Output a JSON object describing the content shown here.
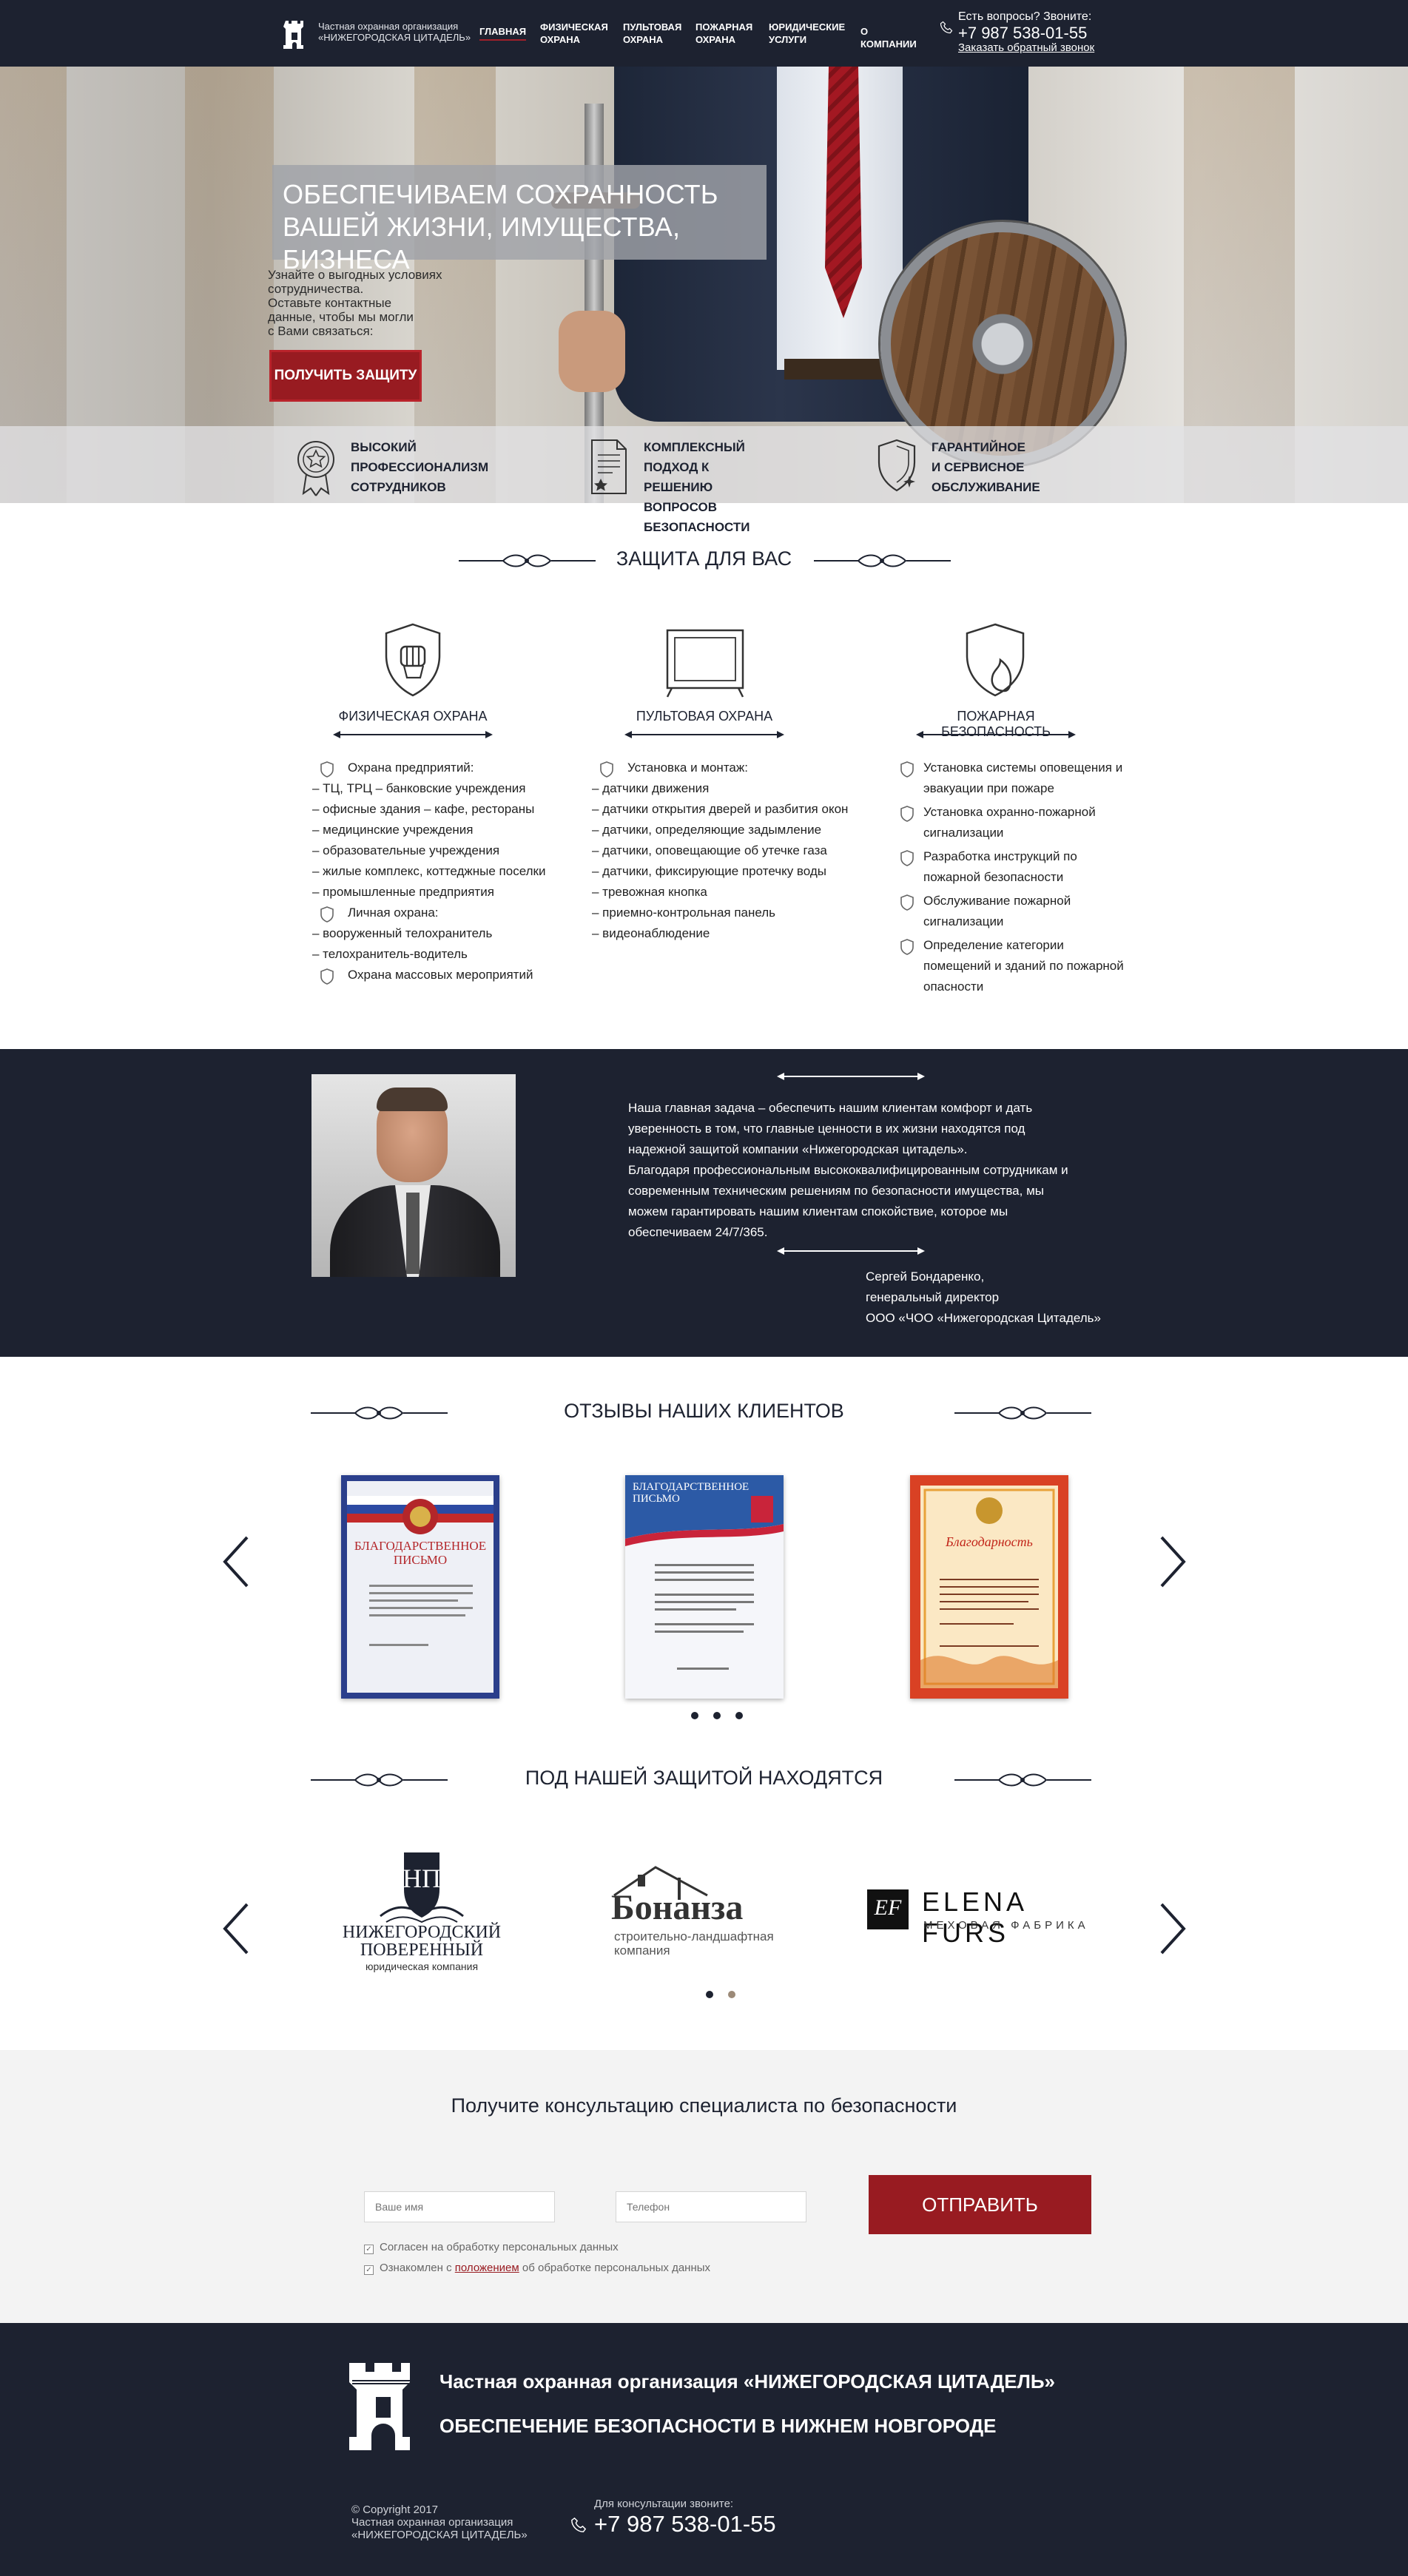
{
  "header": {
    "logo_line1": "Частная охранная организация",
    "logo_line2": "«НИЖЕГОРОДСКАЯ ЦИТАДЕЛЬ»",
    "nav": [
      {
        "label": "ГЛАВНАЯ",
        "active": true
      },
      {
        "label": "ФИЗИЧЕСКАЯ\nОХРАНА",
        "active": false
      },
      {
        "label": "ПУЛЬТОВАЯ\nОХРАНА",
        "active": false
      },
      {
        "label": "ПОЖАРНАЯ\nОХРАНА",
        "active": false
      },
      {
        "label": "ЮРИДИЧЕСКИЕ\nУСЛУГИ",
        "active": false
      },
      {
        "label": "О КОМПАНИИ",
        "active": false
      }
    ],
    "question": "Есть вопросы? Звоните:",
    "phone": "+7 987 538-01-55",
    "callback": "Заказать обратный звонок"
  },
  "hero": {
    "title_line1": "ОБЕСПЕЧИВАЕМ СОХРАННОСТЬ",
    "title_line2": "ВАШЕЙ ЖИЗНИ, ИМУЩЕСТВА, БИЗНЕСА",
    "subtitle_lines": [
      "Узнайте о выгодных условиях",
      "сотрудничества.",
      "Оставьте контактные",
      "данные, чтобы мы могли",
      "с Вами связаться:"
    ],
    "cta": "ПОЛУЧИТЬ ЗАЩИТУ",
    "features": [
      {
        "icon": "award-star-icon",
        "text": "ВЫСОКИЙ\nПРОФЕССИОНАЛИЗМ\nСОТРУДНИКОВ"
      },
      {
        "icon": "document-star-icon",
        "text": "КОМПЛЕКСНЫЙ\nПОДХОД К РЕШЕНИЮ\nВОПРОСОВ БЕЗОПАСНОСТИ"
      },
      {
        "icon": "shield-sparkle-icon",
        "text": "ГАРАНТИЙНОЕ\nИ СЕРВИСНОЕ\nОБСЛУЖИВАНИЕ"
      }
    ]
  },
  "protection": {
    "title": "ЗАЩИТА ДЛЯ ВАС",
    "services": [
      {
        "icon": "fist-shield-icon",
        "name": "ФИЗИЧЕСКАЯ ОХРАНА"
      },
      {
        "icon": "monitor-icon",
        "name": "ПУЛЬТОВАЯ ОХРАНА"
      },
      {
        "icon": "fire-shield-icon",
        "name": "ПОЖАРНАЯ БЕЗОПАСНОСТЬ"
      }
    ],
    "physical_list": [
      {
        "bullet": true,
        "text": "Охрана предприятий:"
      },
      {
        "bullet": false,
        "text": "– ТЦ, ТРЦ – банковские учреждения"
      },
      {
        "bullet": false,
        "text": "– офисные здания – кафе, рестораны"
      },
      {
        "bullet": false,
        "text": "– медицинские учреждения"
      },
      {
        "bullet": false,
        "text": "– образовательные учреждения"
      },
      {
        "bullet": false,
        "text": "– жилые комплекс, коттеджные поселки"
      },
      {
        "bullet": false,
        "text": "– промышленные предприятия"
      },
      {
        "bullet": true,
        "text": "Личная охрана:"
      },
      {
        "bullet": false,
        "text": "– вооруженный телохранитель"
      },
      {
        "bullet": false,
        "text": "– телохранитель-водитель"
      },
      {
        "bullet": true,
        "text": "Охрана массовых мероприятий"
      }
    ],
    "remote_list": [
      {
        "bullet": true,
        "text": "Установка и монтаж:"
      },
      {
        "bullet": false,
        "text": "– датчики движения"
      },
      {
        "bullet": false,
        "text": "– датчики открытия дверей и разбития окон"
      },
      {
        "bullet": false,
        "text": "– датчики, определяющие задымление"
      },
      {
        "bullet": false,
        "text": "– датчики, оповещающие об утечке газа"
      },
      {
        "bullet": false,
        "text": "– датчики, фиксирующие протечку воды"
      },
      {
        "bullet": false,
        "text": "– тревожная кнопка"
      },
      {
        "bullet": false,
        "text": "– приемно-контрольная панель"
      },
      {
        "bullet": false,
        "text": "– видеонаблюдение"
      }
    ],
    "fire_list": [
      "Установка системы оповещения и\nэвакуации при пожаре",
      "Установка охранно-пожарной\nсигнализации",
      "Разработка инструкций по\nпожарной безопасности",
      "Обслуживание пожарной\nсигнализации",
      "Определение категории\nпомещений и зданий по пожарной\nопасности"
    ]
  },
  "director": {
    "quote_lines": [
      "Наша главная задача – обеспечить нашим клиентам комфорт и дать",
      "уверенность в том, что главные ценности в их жизни находятся под",
      "надежной защитой компании «Нижегородская цитадель».",
      "Благодаря профессиональным высококвалифицированным сотрудникам и",
      "современным техническим решениям по безопасности имущества, мы",
      "можем гарантировать нашим клиентам спокойствие, которое мы",
      "обеспечиваем 24/7/365."
    ],
    "sign_lines": [
      "Сергей Бондаренко,",
      "генеральный директор",
      "ООО «ЧОО «Нижегородская Цитадель»"
    ]
  },
  "reviews": {
    "title": "ОТЗЫВЫ НАШИХ КЛИЕНТОВ",
    "letters": [
      {
        "heading": "БЛАГОДАРСТВЕННОЕ\nПИСЬМО",
        "color": "#2b3f8c"
      },
      {
        "heading": "БЛАГОДАРСТВЕННОЕ\nПИСЬМО",
        "color": "#2c5aa6"
      },
      {
        "heading": "Благодарность",
        "color": "#d73a1f"
      }
    ],
    "dots": 3,
    "active_dot": 0
  },
  "clients": {
    "title": "ПОД НАШЕЙ ЗАЩИТОЙ НАХОДЯТСЯ",
    "logos": [
      {
        "mono": "НП",
        "line1": "НИЖЕГОРОДСКИЙ",
        "line2": "ПОВЕРЕННЫЙ",
        "line3": "юридическая компания"
      },
      {
        "name": "Бонанза",
        "line1": "строительно-ландшафтная",
        "line2": "компания"
      },
      {
        "mono": "EF",
        "name": "ELENA FURS",
        "line1": "МЕХОВАЯ ФАБРИКА"
      }
    ],
    "dots": 2,
    "active_dot": 1
  },
  "form": {
    "title": "Получите консультацию специалиста по безопасности",
    "name_placeholder": "Ваше имя",
    "phone_placeholder": "Телефон",
    "submit": "ОТПРАВИТЬ",
    "consent1": "Согласен на обработку персональных данных",
    "consent2_pre": "Ознакомлен с ",
    "consent2_link": "положением",
    "consent2_post": " об обработке персональных данных"
  },
  "footer": {
    "line1": "Частная охранная организация «НИЖЕГОРОДСКАЯ ЦИТАДЕЛЬ»",
    "line2": "ОБЕСПЕЧЕНИЕ БЕЗОПАСНОСТИ В НИЖНЕМ НОВГОРОДЕ",
    "copyright_lines": [
      "© Copyright 2017",
      "Частная охранная организация",
      "«НИЖЕГОРОДСКАЯ ЦИТАДЕЛЬ»"
    ],
    "call_label": "Для консультации звоните:",
    "phone": "+7 987 538-01-55"
  },
  "colors": {
    "dark": "#1d2230",
    "accent": "#981b21"
  }
}
